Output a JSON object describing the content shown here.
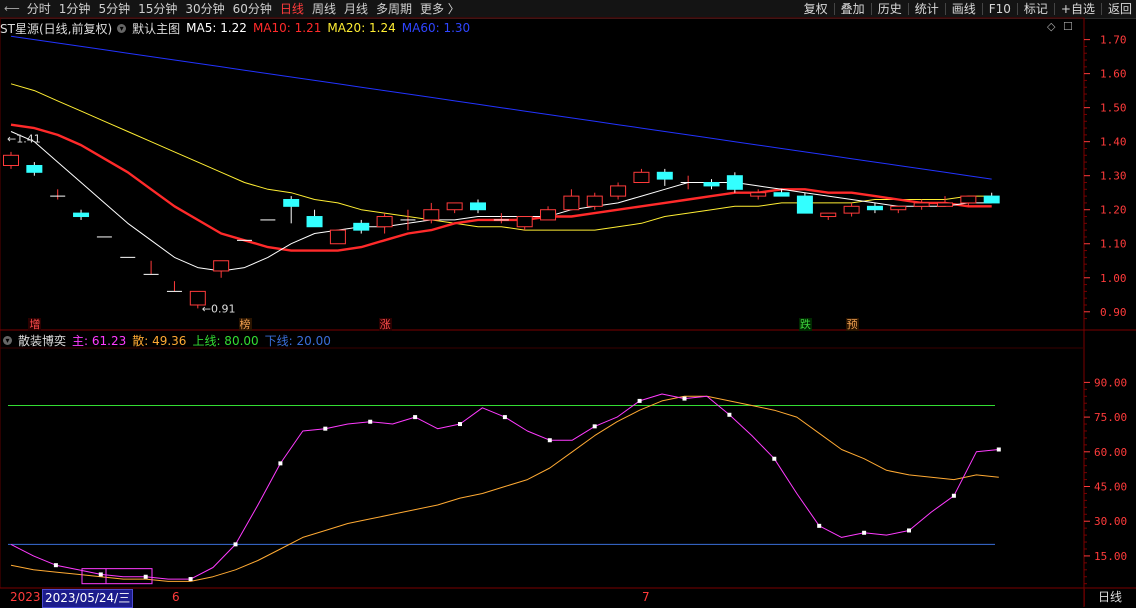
{
  "toolbar": {
    "periods": [
      "分时",
      "1分钟",
      "5分钟",
      "15分钟",
      "30分钟",
      "60分钟",
      "日线",
      "周线",
      "月线",
      "多周期",
      "更多 〉"
    ],
    "active_period": "日线",
    "tools": [
      "复权",
      "叠加",
      "历史",
      "统计",
      "画线",
      "F10",
      "标记",
      "+自选",
      "返回"
    ]
  },
  "main_legend": {
    "stock": "ST星源(日线,前复权)",
    "indicator": "默认主图",
    "ma5": "MA5: 1.22",
    "ma10": "MA10: 1.21",
    "ma20": "MA20: 1.24",
    "ma60": "MA60: 1.30",
    "colors": {
      "ma5": "#ffffff",
      "ma10": "#ff2a2a",
      "ma20": "#ffee33",
      "ma60": "#2233ff"
    }
  },
  "sub_legend": {
    "indicator": "散装博奕",
    "main": "主: 61.23",
    "san": "散: 49.36",
    "upper": "上线: 80.00",
    "lower": "下线: 20.00",
    "colors": {
      "main": "#ff3bff",
      "san": "#ffaa33",
      "upper": "#33dd33",
      "lower": "#3a6ed8"
    }
  },
  "price_axis": [
    "1.70",
    "1.60",
    "1.50",
    "1.40",
    "1.30",
    "1.20",
    "1.10",
    "1.00",
    "0.90"
  ],
  "osc_axis": [
    "90.00",
    "75.00",
    "60.00",
    "45.00",
    "30.00",
    "15.00"
  ],
  "annotations": {
    "high": "1.41",
    "low": "0.91"
  },
  "event_tags": [
    {
      "text": "增",
      "style": "red"
    },
    {
      "text": "榜",
      "style": "orange"
    },
    {
      "text": "涨",
      "style": "red"
    },
    {
      "text": "跌",
      "style": "green"
    },
    {
      "text": "预",
      "style": "orange"
    }
  ],
  "date_axis": {
    "year": "2023",
    "cursor_date": "2023/05/24/三",
    "months": [
      "6",
      "7"
    ]
  },
  "period_tag": "日线",
  "chart_data": [
    {
      "type": "candlestick",
      "title": "ST星源(日线,前复权)",
      "ylim": [
        0.87,
        1.74
      ],
      "candles": [
        {
          "o": 1.33,
          "h": 1.37,
          "l": 1.32,
          "c": 1.36
        },
        {
          "o": 1.33,
          "h": 1.34,
          "l": 1.3,
          "c": 1.31
        },
        {
          "o": 1.24,
          "h": 1.26,
          "l": 1.23,
          "c": 1.24
        },
        {
          "o": 1.19,
          "h": 1.2,
          "l": 1.17,
          "c": 1.18
        },
        {
          "o": 1.12,
          "h": 1.12,
          "l": 1.12,
          "c": 1.12
        },
        {
          "o": 1.06,
          "h": 1.06,
          "l": 1.06,
          "c": 1.06
        },
        {
          "o": 1.01,
          "h": 1.05,
          "l": 1.01,
          "c": 1.01
        },
        {
          "o": 0.96,
          "h": 0.99,
          "l": 0.96,
          "c": 0.96
        },
        {
          "o": 0.92,
          "h": 0.96,
          "l": 0.91,
          "c": 0.96
        },
        {
          "o": 1.02,
          "h": 1.05,
          "l": 1.0,
          "c": 1.05
        },
        {
          "o": 1.11,
          "h": 1.11,
          "l": 1.11,
          "c": 1.11
        },
        {
          "o": 1.17,
          "h": 1.17,
          "l": 1.17,
          "c": 1.17
        },
        {
          "o": 1.23,
          "h": 1.24,
          "l": 1.16,
          "c": 1.21
        },
        {
          "o": 1.18,
          "h": 1.2,
          "l": 1.15,
          "c": 1.15
        },
        {
          "o": 1.1,
          "h": 1.14,
          "l": 1.1,
          "c": 1.14
        },
        {
          "o": 1.16,
          "h": 1.17,
          "l": 1.13,
          "c": 1.14
        },
        {
          "o": 1.15,
          "h": 1.19,
          "l": 1.13,
          "c": 1.18
        },
        {
          "o": 1.17,
          "h": 1.2,
          "l": 1.14,
          "c": 1.17
        },
        {
          "o": 1.17,
          "h": 1.22,
          "l": 1.16,
          "c": 1.2
        },
        {
          "o": 1.2,
          "h": 1.22,
          "l": 1.19,
          "c": 1.22
        },
        {
          "o": 1.22,
          "h": 1.23,
          "l": 1.19,
          "c": 1.2
        },
        {
          "o": 1.17,
          "h": 1.19,
          "l": 1.16,
          "c": 1.17
        },
        {
          "o": 1.15,
          "h": 1.18,
          "l": 1.14,
          "c": 1.18
        },
        {
          "o": 1.17,
          "h": 1.21,
          "l": 1.17,
          "c": 1.2
        },
        {
          "o": 1.2,
          "h": 1.26,
          "l": 1.2,
          "c": 1.24
        },
        {
          "o": 1.21,
          "h": 1.25,
          "l": 1.2,
          "c": 1.24
        },
        {
          "o": 1.24,
          "h": 1.28,
          "l": 1.23,
          "c": 1.27
        },
        {
          "o": 1.28,
          "h": 1.32,
          "l": 1.28,
          "c": 1.31
        },
        {
          "o": 1.31,
          "h": 1.32,
          "l": 1.27,
          "c": 1.29
        },
        {
          "o": 1.28,
          "h": 1.3,
          "l": 1.26,
          "c": 1.28
        },
        {
          "o": 1.28,
          "h": 1.29,
          "l": 1.26,
          "c": 1.27
        },
        {
          "o": 1.3,
          "h": 1.31,
          "l": 1.25,
          "c": 1.26
        },
        {
          "o": 1.24,
          "h": 1.26,
          "l": 1.23,
          "c": 1.25
        },
        {
          "o": 1.25,
          "h": 1.26,
          "l": 1.24,
          "c": 1.24
        },
        {
          "o": 1.24,
          "h": 1.25,
          "l": 1.19,
          "c": 1.19
        },
        {
          "o": 1.18,
          "h": 1.19,
          "l": 1.17,
          "c": 1.19
        },
        {
          "o": 1.19,
          "h": 1.22,
          "l": 1.18,
          "c": 1.21
        },
        {
          "o": 1.21,
          "h": 1.22,
          "l": 1.19,
          "c": 1.2
        },
        {
          "o": 1.2,
          "h": 1.21,
          "l": 1.19,
          "c": 1.21
        },
        {
          "o": 1.21,
          "h": 1.23,
          "l": 1.2,
          "c": 1.22
        },
        {
          "o": 1.21,
          "h": 1.24,
          "l": 1.21,
          "c": 1.22
        },
        {
          "o": 1.22,
          "h": 1.24,
          "l": 1.21,
          "c": 1.24
        },
        {
          "o": 1.24,
          "h": 1.25,
          "l": 1.22,
          "c": 1.22
        }
      ],
      "ma5": [
        1.43,
        1.4,
        1.34,
        1.28,
        1.22,
        1.16,
        1.11,
        1.06,
        1.03,
        1.02,
        1.03,
        1.06,
        1.1,
        1.13,
        1.14,
        1.15,
        1.15,
        1.16,
        1.17,
        1.17,
        1.18,
        1.18,
        1.18,
        1.18,
        1.2,
        1.21,
        1.22,
        1.24,
        1.26,
        1.28,
        1.28,
        1.28,
        1.27,
        1.26,
        1.25,
        1.24,
        1.23,
        1.22,
        1.21,
        1.21,
        1.21,
        1.22,
        1.22
      ],
      "ma10": [
        1.45,
        1.44,
        1.42,
        1.39,
        1.35,
        1.31,
        1.26,
        1.21,
        1.17,
        1.13,
        1.11,
        1.09,
        1.08,
        1.08,
        1.08,
        1.09,
        1.11,
        1.13,
        1.14,
        1.16,
        1.17,
        1.17,
        1.17,
        1.18,
        1.18,
        1.19,
        1.2,
        1.21,
        1.22,
        1.23,
        1.24,
        1.25,
        1.25,
        1.26,
        1.26,
        1.25,
        1.25,
        1.24,
        1.23,
        1.22,
        1.22,
        1.21,
        1.21
      ],
      "ma20": [
        1.57,
        1.55,
        1.52,
        1.49,
        1.46,
        1.43,
        1.4,
        1.37,
        1.34,
        1.31,
        1.28,
        1.26,
        1.25,
        1.23,
        1.22,
        1.2,
        1.19,
        1.18,
        1.17,
        1.16,
        1.15,
        1.15,
        1.14,
        1.14,
        1.14,
        1.14,
        1.15,
        1.16,
        1.18,
        1.19,
        1.2,
        1.21,
        1.21,
        1.22,
        1.22,
        1.22,
        1.22,
        1.23,
        1.23,
        1.23,
        1.23,
        1.24,
        1.24
      ],
      "ma60": [
        1.71,
        1.7,
        1.69,
        1.68,
        1.67,
        1.66,
        1.65,
        1.64,
        1.63,
        1.62,
        1.61,
        1.6,
        1.59,
        1.58,
        1.57,
        1.56,
        1.55,
        1.54,
        1.53,
        1.52,
        1.51,
        1.5,
        1.49,
        1.48,
        1.47,
        1.46,
        1.45,
        1.44,
        1.43,
        1.42,
        1.41,
        1.4,
        1.39,
        1.38,
        1.37,
        1.36,
        1.35,
        1.34,
        1.33,
        1.32,
        1.31,
        1.3,
        1.29
      ],
      "yticks": [
        1.7,
        1.6,
        1.5,
        1.4,
        1.3,
        1.2,
        1.1,
        1.0,
        0.9
      ]
    },
    {
      "type": "line",
      "title": "散装博奕",
      "ylim": [
        2,
        104
      ],
      "upper": 80,
      "lower": 20,
      "series": [
        {
          "name": "主",
          "values": [
            20,
            15,
            11,
            9,
            7,
            6,
            6,
            5,
            5,
            10,
            20,
            37,
            55,
            69,
            70,
            72,
            73,
            72,
            75,
            70,
            72,
            79,
            75,
            69,
            65,
            65,
            71,
            75,
            82,
            85,
            83,
            84,
            76,
            67,
            57,
            42,
            28,
            23,
            25,
            24,
            26,
            34,
            41,
            60,
            61
          ]
        },
        {
          "name": "散",
          "values": [
            11,
            9,
            8,
            7,
            6,
            5,
            5,
            4,
            4,
            6,
            9,
            13,
            18,
            23,
            26,
            29,
            31,
            33,
            35,
            37,
            40,
            42,
            45,
            48,
            53,
            60,
            67,
            73,
            78,
            82,
            84,
            84,
            82,
            80,
            78,
            75,
            68,
            61,
            57,
            52,
            50,
            49,
            48,
            50,
            49
          ]
        }
      ],
      "yticks": [
        90,
        75,
        60,
        45,
        30,
        15
      ]
    }
  ]
}
